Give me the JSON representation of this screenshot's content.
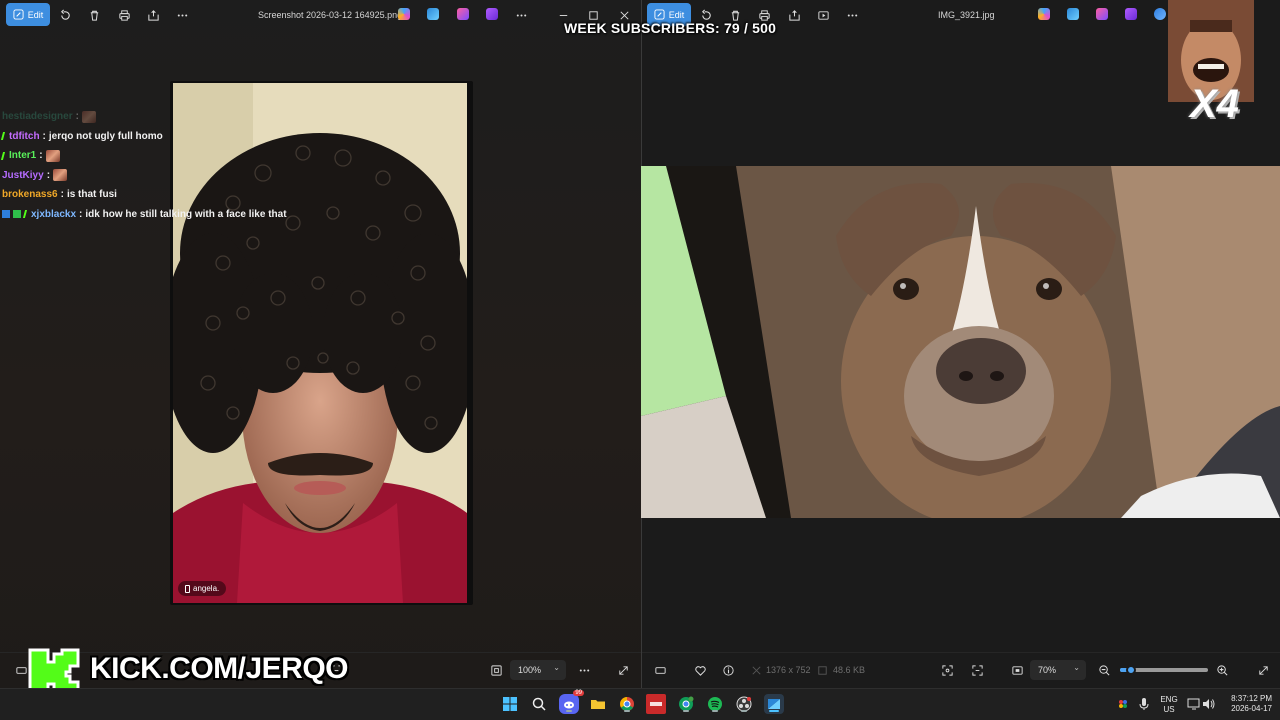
{
  "overlay": {
    "subs_text": "WEEK SUBSCRIBERS: 79 / 500",
    "multiplier": "X4",
    "kick_url": "KICK.COM/JERQO"
  },
  "left_window": {
    "edit_label": "Edit",
    "title": "Screenshot 2026-03-12 164925.png",
    "zoom": "100%",
    "photo_caption": "angela."
  },
  "right_window": {
    "edit_label": "Edit",
    "title": "IMG_3921.jpg",
    "dimensions": "1376 x 752",
    "file_size": "48.6 KB",
    "zoom": "70%",
    "zoom_slider_fraction": 0.12
  },
  "chat": [
    {
      "user": "hestiadesigner",
      "color": "#3a9a7a",
      "message": "",
      "emote": true,
      "faded": true,
      "badges": []
    },
    {
      "user": "tdfitch",
      "color": "#c46cff",
      "message": "jerqo not ugly full homo",
      "emote": false,
      "faded": false,
      "badges": [
        "sub"
      ]
    },
    {
      "user": "Inter1",
      "color": "#59f05a",
      "message": "",
      "emote": true,
      "faded": false,
      "badges": [
        "sub"
      ]
    },
    {
      "user": "JustKiyy",
      "color": "#b56cff",
      "message": "",
      "emote": true,
      "faded": false,
      "badges": []
    },
    {
      "user": "brokenass6",
      "color": "#f0a828",
      "message": "is that fusi",
      "emote": false,
      "faded": false,
      "badges": []
    },
    {
      "user": "xjxblackx",
      "color": "#7fb8ff",
      "message": "idk how he still talking with a face like that",
      "emote": false,
      "faded": false,
      "badges": [
        "mod",
        "verified",
        "sub"
      ]
    }
  ],
  "taskbar": {
    "lang": "ENG",
    "region": "US",
    "time": "8:37:12 PM",
    "date": "2026-04-17",
    "discord_badge": "99"
  },
  "colors": {
    "accent": "#3d8ee0",
    "kick_green": "#53fc18"
  }
}
